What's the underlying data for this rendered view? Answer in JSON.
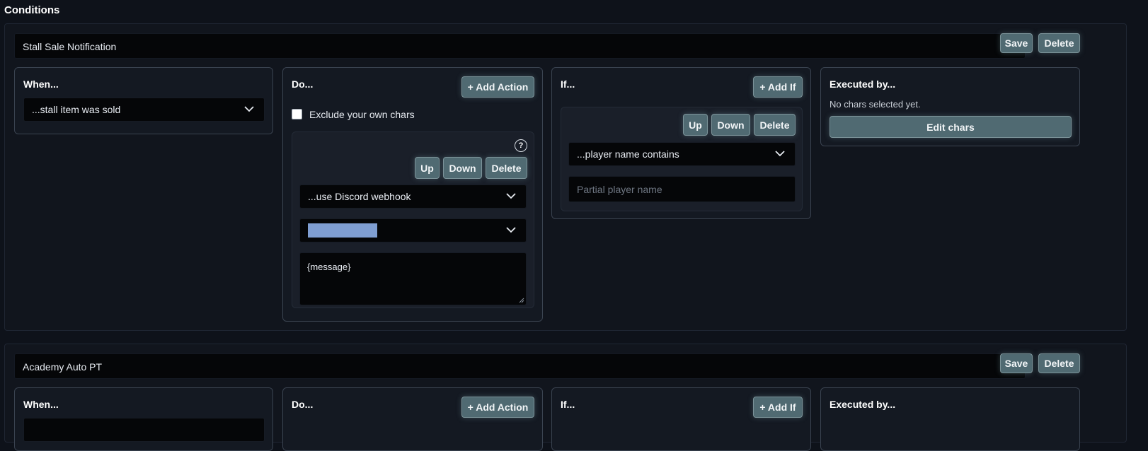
{
  "section_title": "Conditions",
  "conditions": [
    {
      "name": "Stall Sale Notification",
      "save_label": "Save",
      "delete_label": "Delete",
      "when": {
        "title": "When...",
        "trigger": "...stall item was sold"
      },
      "do": {
        "title": "Do...",
        "add_action_label": "+ Add Action",
        "exclude_own_label": "Exclude your own chars",
        "exclude_own_checked": false,
        "action": {
          "help_label": "?",
          "up_label": "Up",
          "down_label": "Down",
          "delete_label": "Delete",
          "action_type": "...use Discord webhook",
          "webhook_value": "",
          "message": "{message}"
        }
      },
      "if": {
        "title": "If...",
        "add_if_label": "+ Add If",
        "condition": {
          "up_label": "Up",
          "down_label": "Down",
          "delete_label": "Delete",
          "type": "...player name contains",
          "placeholder": "Partial player name"
        }
      },
      "executed_by": {
        "title": "Executed by...",
        "status": "No chars selected yet.",
        "edit_label": "Edit chars"
      }
    },
    {
      "name": "Academy Auto PT",
      "save_label": "Save",
      "delete_label": "Delete",
      "when": {
        "title": "When..."
      },
      "do": {
        "title": "Do...",
        "add_action_label": "+ Add Action"
      },
      "if": {
        "title": "If...",
        "add_if_label": "+ Add If"
      },
      "executed_by": {
        "title": "Executed by..."
      }
    }
  ],
  "colors": {
    "background": "#0e121a",
    "button": "#506a72",
    "input": "#050608",
    "webhook_swatch": "#7f9ed2"
  },
  "icons": [
    "chevron-down-icon",
    "help-icon",
    "checkbox-icon",
    "resize-grip-icon"
  ]
}
